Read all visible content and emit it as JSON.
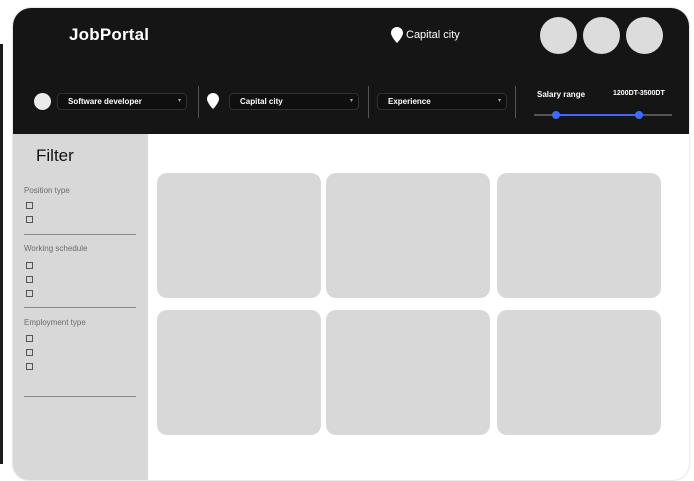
{
  "app": {
    "logo": "JobPortal"
  },
  "header": {
    "location": "Capital city",
    "avatars": [
      "avatar-1",
      "avatar-2",
      "avatar-3"
    ]
  },
  "filters": {
    "position": {
      "value": "Software developer"
    },
    "city": {
      "value": "Capital city"
    },
    "experience": {
      "value": "Experience"
    },
    "salary": {
      "label": "Salary range",
      "value": "1200DT-3500DT",
      "range_fraction": [
        0.16,
        0.77
      ]
    }
  },
  "sidebar": {
    "title": "Filter",
    "sections": [
      {
        "label": "Position type",
        "checkbox_count": 2
      },
      {
        "label": "Working schedule",
        "checkbox_count": 3
      },
      {
        "label": "Employment type",
        "checkbox_count": 3
      }
    ]
  },
  "results": {
    "card_count": 6
  },
  "colors": {
    "header_bg": "#151515",
    "sidebar_bg": "#d8d8d8",
    "card_bg": "#d8d8d8",
    "slider_accent": "#3f6bff"
  },
  "icons": {
    "location": "location-pin-icon",
    "profile": "circle-icon",
    "dropdown": "chevron-down-icon"
  }
}
